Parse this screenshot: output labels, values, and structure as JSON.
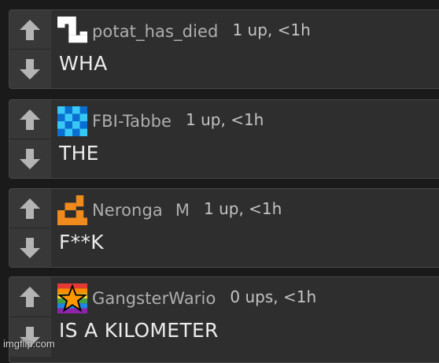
{
  "comments": [
    {
      "username": "potat_has_died",
      "flair": "",
      "meta": "1 up, <1h",
      "text": "WHA"
    },
    {
      "username": "FBI-Tabbe",
      "flair": "",
      "meta": "1 up, <1h",
      "text": "THE"
    },
    {
      "username": "Neronga",
      "flair": "M",
      "meta": "1 up, <1h",
      "text": "F**K"
    },
    {
      "username": "GangsterWario",
      "flair": "",
      "meta": "0 ups, <1h",
      "text": "IS A KILOMETER"
    }
  ],
  "icons": {
    "upvote": "arrow-up-icon",
    "downvote": "arrow-down-icon",
    "avatars": [
      "pixel-avatar-white",
      "pixel-avatar-cyan-checker",
      "pixel-avatar-orange",
      "pixel-avatar-rainbow-star"
    ]
  },
  "colors": {
    "background": "#1a1a1a",
    "panel": "#2e2e2e",
    "vote_button": "#383838",
    "vote_arrow": "#b4b4b4",
    "username": "#aeaeae",
    "text": "#ececec"
  },
  "watermark": "imgflip.com"
}
